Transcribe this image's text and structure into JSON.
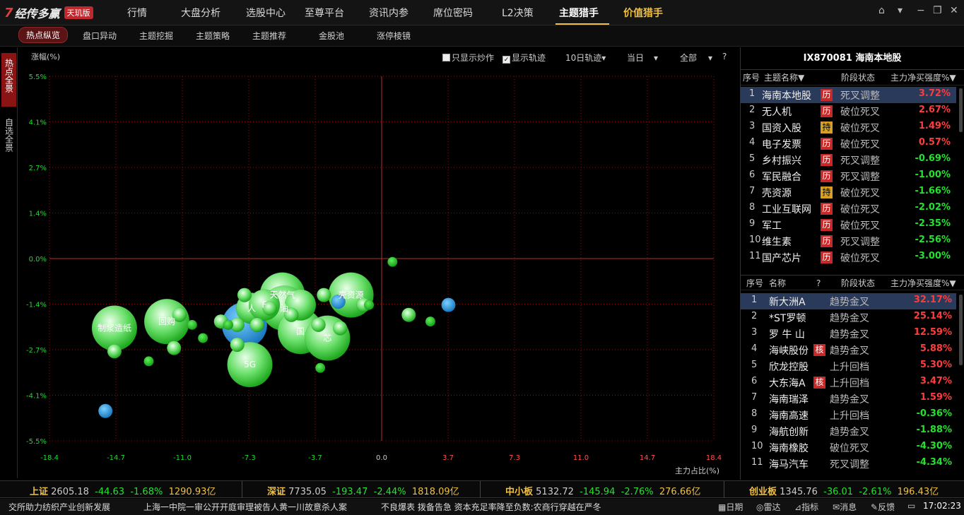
{
  "app": {
    "logo_text": "经传多赢",
    "edition_badge": "天玑版"
  },
  "topnav": [
    "行情",
    "大盘分析",
    "选股中心",
    "至尊平台",
    "资讯内参",
    "席位密码",
    "L2决策",
    "主题猎手",
    "价值猎手"
  ],
  "subnav": [
    "热点纵览",
    "盘口异动",
    "主题挖掘",
    "主题策略",
    "主题推荐",
    "金股池",
    "涨停棱镜"
  ],
  "side_tabs": [
    "热点全景",
    "自选全景"
  ],
  "chart_controls": {
    "only_speculative": "只显示炒作",
    "show_trail": "显示轨迹",
    "trail_days": "10日轨迹",
    "period": "当日",
    "scope": "全部",
    "help": "?"
  },
  "chart_data": {
    "type": "scatter",
    "ylabel": "涨幅(%)",
    "xlabel": "主力占比(%)",
    "ylim": [
      -5.5,
      5.5
    ],
    "xlim": [
      -18.4,
      18.4
    ],
    "y_ticks": [
      "5.5%",
      "4.1%",
      "2.7%",
      "1.4%",
      "0.0%",
      "-1.4%",
      "-2.7%",
      "-4.1%",
      "-5.5%"
    ],
    "x_ticks": [
      "-18.4",
      "-14.7",
      "-11.0",
      "-7.3",
      "-3.7",
      "0.0",
      "3.7",
      "7.3",
      "11.0",
      "14.7",
      "18.4"
    ],
    "points": [
      {
        "label": "制浆造纸",
        "x": -14.8,
        "y": -2.1,
        "size": "large",
        "color": "green"
      },
      {
        "label": "",
        "x": -14.8,
        "y": -2.8,
        "size": "small",
        "color": "green"
      },
      {
        "label": "",
        "x": -15.3,
        "y": -4.6,
        "size": "small",
        "color": "blue"
      },
      {
        "label": "",
        "x": -12.9,
        "y": -3.1,
        "size": "tiny",
        "color": "green"
      },
      {
        "label": "回购",
        "x": -11.9,
        "y": -1.9,
        "size": "large",
        "color": "green"
      },
      {
        "label": "",
        "x": -11.2,
        "y": -1.7,
        "size": "small",
        "color": "green"
      },
      {
        "label": "",
        "x": -11.5,
        "y": -2.7,
        "size": "small",
        "color": "green"
      },
      {
        "label": "",
        "x": -10.5,
        "y": -2.0,
        "size": "tiny",
        "color": "green"
      },
      {
        "label": "",
        "x": -9.9,
        "y": -2.4,
        "size": "tiny",
        "color": "green"
      },
      {
        "label": "",
        "x": -8.9,
        "y": -1.9,
        "size": "small",
        "color": "green"
      },
      {
        "label": "",
        "x": -8.5,
        "y": -2.0,
        "size": "tiny",
        "color": "green"
      },
      {
        "label": "",
        "x": -7.6,
        "y": -2.0,
        "size": "large",
        "color": "blue"
      },
      {
        "label": "",
        "x": -8.0,
        "y": -2.0,
        "size": "small",
        "color": "green"
      },
      {
        "label": "",
        "x": -8.0,
        "y": -2.6,
        "size": "small",
        "color": "green"
      },
      {
        "label": "5G",
        "x": -7.3,
        "y": -3.2,
        "size": "large",
        "color": "green"
      },
      {
        "label": "人",
        "x": -7.2,
        "y": -1.5,
        "size": "medium",
        "color": "green"
      },
      {
        "label": "F",
        "x": -6.5,
        "y": -1.4,
        "size": "medium",
        "color": "green"
      },
      {
        "label": "",
        "x": -7.6,
        "y": -1.1,
        "size": "small",
        "color": "green"
      },
      {
        "label": "",
        "x": -6.2,
        "y": -1.5,
        "size": "small",
        "color": "green"
      },
      {
        "label": "",
        "x": -6.9,
        "y": -2.0,
        "size": "small",
        "color": "green"
      },
      {
        "label": "天然气",
        "x": -5.5,
        "y": -1.1,
        "size": "large",
        "color": "green"
      },
      {
        "label": "油",
        "x": -5.4,
        "y": -1.5,
        "size": "large",
        "color": "green"
      },
      {
        "label": "",
        "x": -5.0,
        "y": -1.7,
        "size": "small",
        "color": "green"
      },
      {
        "label": "",
        "x": -4.5,
        "y": -1.4,
        "size": "medium",
        "color": "green"
      },
      {
        "label": "国",
        "x": -4.5,
        "y": -2.2,
        "size": "large",
        "color": "green"
      },
      {
        "label": "芯",
        "x": -3.0,
        "y": -2.4,
        "size": "large",
        "color": "green"
      },
      {
        "label": "",
        "x": -3.5,
        "y": -2.0,
        "size": "small",
        "color": "green"
      },
      {
        "label": "",
        "x": -3.2,
        "y": -1.1,
        "size": "small",
        "color": "green"
      },
      {
        "label": "",
        "x": -2.3,
        "y": -2.1,
        "size": "small",
        "color": "green"
      },
      {
        "label": "",
        "x": -3.4,
        "y": -3.3,
        "size": "tiny",
        "color": "green"
      },
      {
        "label": "壳资源",
        "x": -1.7,
        "y": -1.1,
        "size": "large",
        "color": "green"
      },
      {
        "label": "",
        "x": -2.4,
        "y": -1.3,
        "size": "small",
        "color": "blue"
      },
      {
        "label": "",
        "x": -1.0,
        "y": -1.4,
        "size": "small",
        "color": "green"
      },
      {
        "label": "",
        "x": -0.7,
        "y": -1.4,
        "size": "tiny",
        "color": "green"
      },
      {
        "label": "",
        "x": 0.6,
        "y": -0.1,
        "size": "tiny",
        "color": "green"
      },
      {
        "label": "",
        "x": 1.5,
        "y": -1.7,
        "size": "small",
        "color": "green"
      },
      {
        "label": "",
        "x": 2.7,
        "y": -1.9,
        "size": "tiny",
        "color": "green"
      },
      {
        "label": "",
        "x": 3.7,
        "y": -1.4,
        "size": "small",
        "color": "blue"
      }
    ]
  },
  "theme_panel": {
    "title": "IX870081 海南本地股",
    "headers": [
      "序号",
      "主题名称▼",
      "阶段状态",
      "主力净买强度%▼"
    ],
    "rows": [
      {
        "no": "1",
        "name": "海南本地股",
        "badge": "历",
        "badge_type": "li",
        "stage": "死叉调整",
        "value": "3.72%",
        "dir": "up"
      },
      {
        "no": "2",
        "name": "无人机",
        "badge": "历",
        "badge_type": "li",
        "stage": "破位死叉",
        "value": "2.67%",
        "dir": "up"
      },
      {
        "no": "3",
        "name": "国资入股",
        "badge": "持",
        "badge_type": "chi",
        "stage": "破位死叉",
        "value": "1.49%",
        "dir": "up"
      },
      {
        "no": "4",
        "name": "电子发票",
        "badge": "历",
        "badge_type": "li",
        "stage": "破位死叉",
        "value": "0.57%",
        "dir": "up"
      },
      {
        "no": "5",
        "name": "乡村振兴",
        "badge": "历",
        "badge_type": "li",
        "stage": "死叉调整",
        "value": "-0.69%",
        "dir": "down"
      },
      {
        "no": "6",
        "name": "军民融合",
        "badge": "历",
        "badge_type": "li",
        "stage": "死叉调整",
        "value": "-1.00%",
        "dir": "down"
      },
      {
        "no": "7",
        "name": "壳资源",
        "badge": "持",
        "badge_type": "chi",
        "stage": "破位死叉",
        "value": "-1.66%",
        "dir": "down"
      },
      {
        "no": "8",
        "name": "工业互联网",
        "badge": "历",
        "badge_type": "li",
        "stage": "破位死叉",
        "value": "-2.02%",
        "dir": "down"
      },
      {
        "no": "9",
        "name": "军工",
        "badge": "历",
        "badge_type": "li",
        "stage": "破位死叉",
        "value": "-2.35%",
        "dir": "down"
      },
      {
        "no": "10",
        "name": "维生素",
        "badge": "历",
        "badge_type": "li",
        "stage": "死叉调整",
        "value": "-2.56%",
        "dir": "down"
      },
      {
        "no": "11",
        "name": "国产芯片",
        "badge": "历",
        "badge_type": "li",
        "stage": "破位死叉",
        "value": "-3.00%",
        "dir": "down"
      }
    ]
  },
  "stock_panel": {
    "headers": [
      "序号",
      "名称",
      "?",
      "阶段状态",
      "主力净买强度%▼"
    ],
    "rows": [
      {
        "no": "1",
        "name": "新大洲A",
        "badge": "",
        "stage": "趋势金叉",
        "value": "32.17%",
        "dir": "up"
      },
      {
        "no": "2",
        "name": "*ST罗顿",
        "badge": "",
        "stage": "趋势金叉",
        "value": "25.14%",
        "dir": "up"
      },
      {
        "no": "3",
        "name": "罗 牛 山",
        "badge": "",
        "stage": "趋势金叉",
        "value": "12.59%",
        "dir": "up"
      },
      {
        "no": "4",
        "name": "海峡股份",
        "badge": "核",
        "stage": "趋势金叉",
        "value": "5.88%",
        "dir": "up"
      },
      {
        "no": "5",
        "name": "欣龙控股",
        "badge": "",
        "stage": "上升回档",
        "value": "5.30%",
        "dir": "up"
      },
      {
        "no": "6",
        "name": "大东海A",
        "badge": "核",
        "stage": "上升回档",
        "value": "3.47%",
        "dir": "up"
      },
      {
        "no": "7",
        "name": "海南瑞泽",
        "badge": "",
        "stage": "趋势金叉",
        "value": "1.59%",
        "dir": "up"
      },
      {
        "no": "8",
        "name": "海南高速",
        "badge": "",
        "stage": "上升回档",
        "value": "-0.36%",
        "dir": "down"
      },
      {
        "no": "9",
        "name": "海航创新",
        "badge": "",
        "stage": "趋势金叉",
        "value": "-1.88%",
        "dir": "down"
      },
      {
        "no": "10",
        "name": "海南橡胶",
        "badge": "",
        "stage": "破位死叉",
        "value": "-4.30%",
        "dir": "down"
      },
      {
        "no": "11",
        "name": "海马汽车",
        "badge": "",
        "stage": "死叉调整",
        "value": "-4.34%",
        "dir": "down"
      }
    ]
  },
  "indices": [
    {
      "name": "上证",
      "value": "2605.18",
      "change": "-44.63",
      "pct": "-1.68%",
      "amount": "1290.93亿"
    },
    {
      "name": "深证",
      "value": "7735.05",
      "change": "-193.47",
      "pct": "-2.44%",
      "amount": "1818.09亿"
    },
    {
      "name": "中小板",
      "value": "5132.72",
      "change": "-145.94",
      "pct": "-2.76%",
      "amount": "276.66亿"
    },
    {
      "name": "创业板",
      "value": "1345.76",
      "change": "-36.01",
      "pct": "-2.61%",
      "amount": "196.43亿"
    }
  ],
  "news": [
    "交所助力纺织产业创新发展",
    "上海一中院一审公开开庭审理被告人黄一川故意杀人案",
    "不良爆表 拨备告急 资本充足率降至负数:农商行穿越在严冬"
  ],
  "status_buttons": [
    "日期",
    "雷达",
    "指标",
    "消息",
    "反馈"
  ],
  "clock": "17:02:23",
  "colors": {
    "up": "#ff3c3c",
    "down": "#22e22e",
    "accent": "#f0c040",
    "grid": "#7a1818"
  }
}
